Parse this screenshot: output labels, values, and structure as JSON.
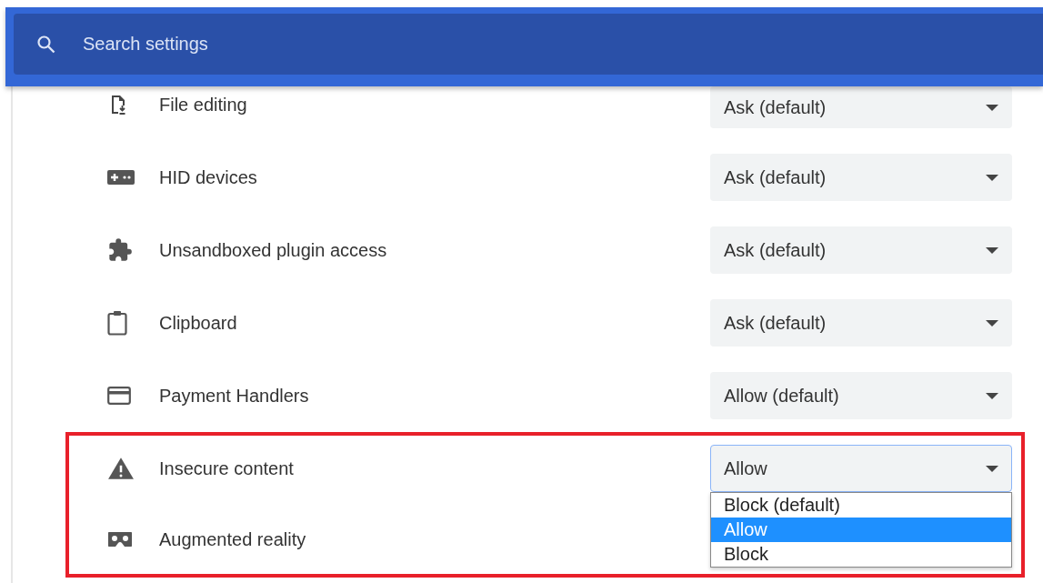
{
  "search": {
    "placeholder": "Search settings"
  },
  "rows": [
    {
      "label": "File editing",
      "value": "Ask (default)",
      "expanded": false
    },
    {
      "label": "HID devices",
      "value": "Ask (default)",
      "expanded": false
    },
    {
      "label": "Unsandboxed plugin access",
      "value": "Ask (default)",
      "expanded": false
    },
    {
      "label": "Clipboard",
      "value": "Ask (default)",
      "expanded": false
    },
    {
      "label": "Payment Handlers",
      "value": "Allow (default)",
      "expanded": false
    }
  ],
  "highlight_frame": {
    "rows": [
      {
        "label": "Insecure content",
        "value": "Allow",
        "expanded": true,
        "options": [
          {
            "label": "Block (default)",
            "selected": false
          },
          {
            "label": "Allow",
            "selected": true
          },
          {
            "label": "Block",
            "selected": false
          }
        ]
      },
      {
        "label": "Augmented reality"
      }
    ]
  }
}
